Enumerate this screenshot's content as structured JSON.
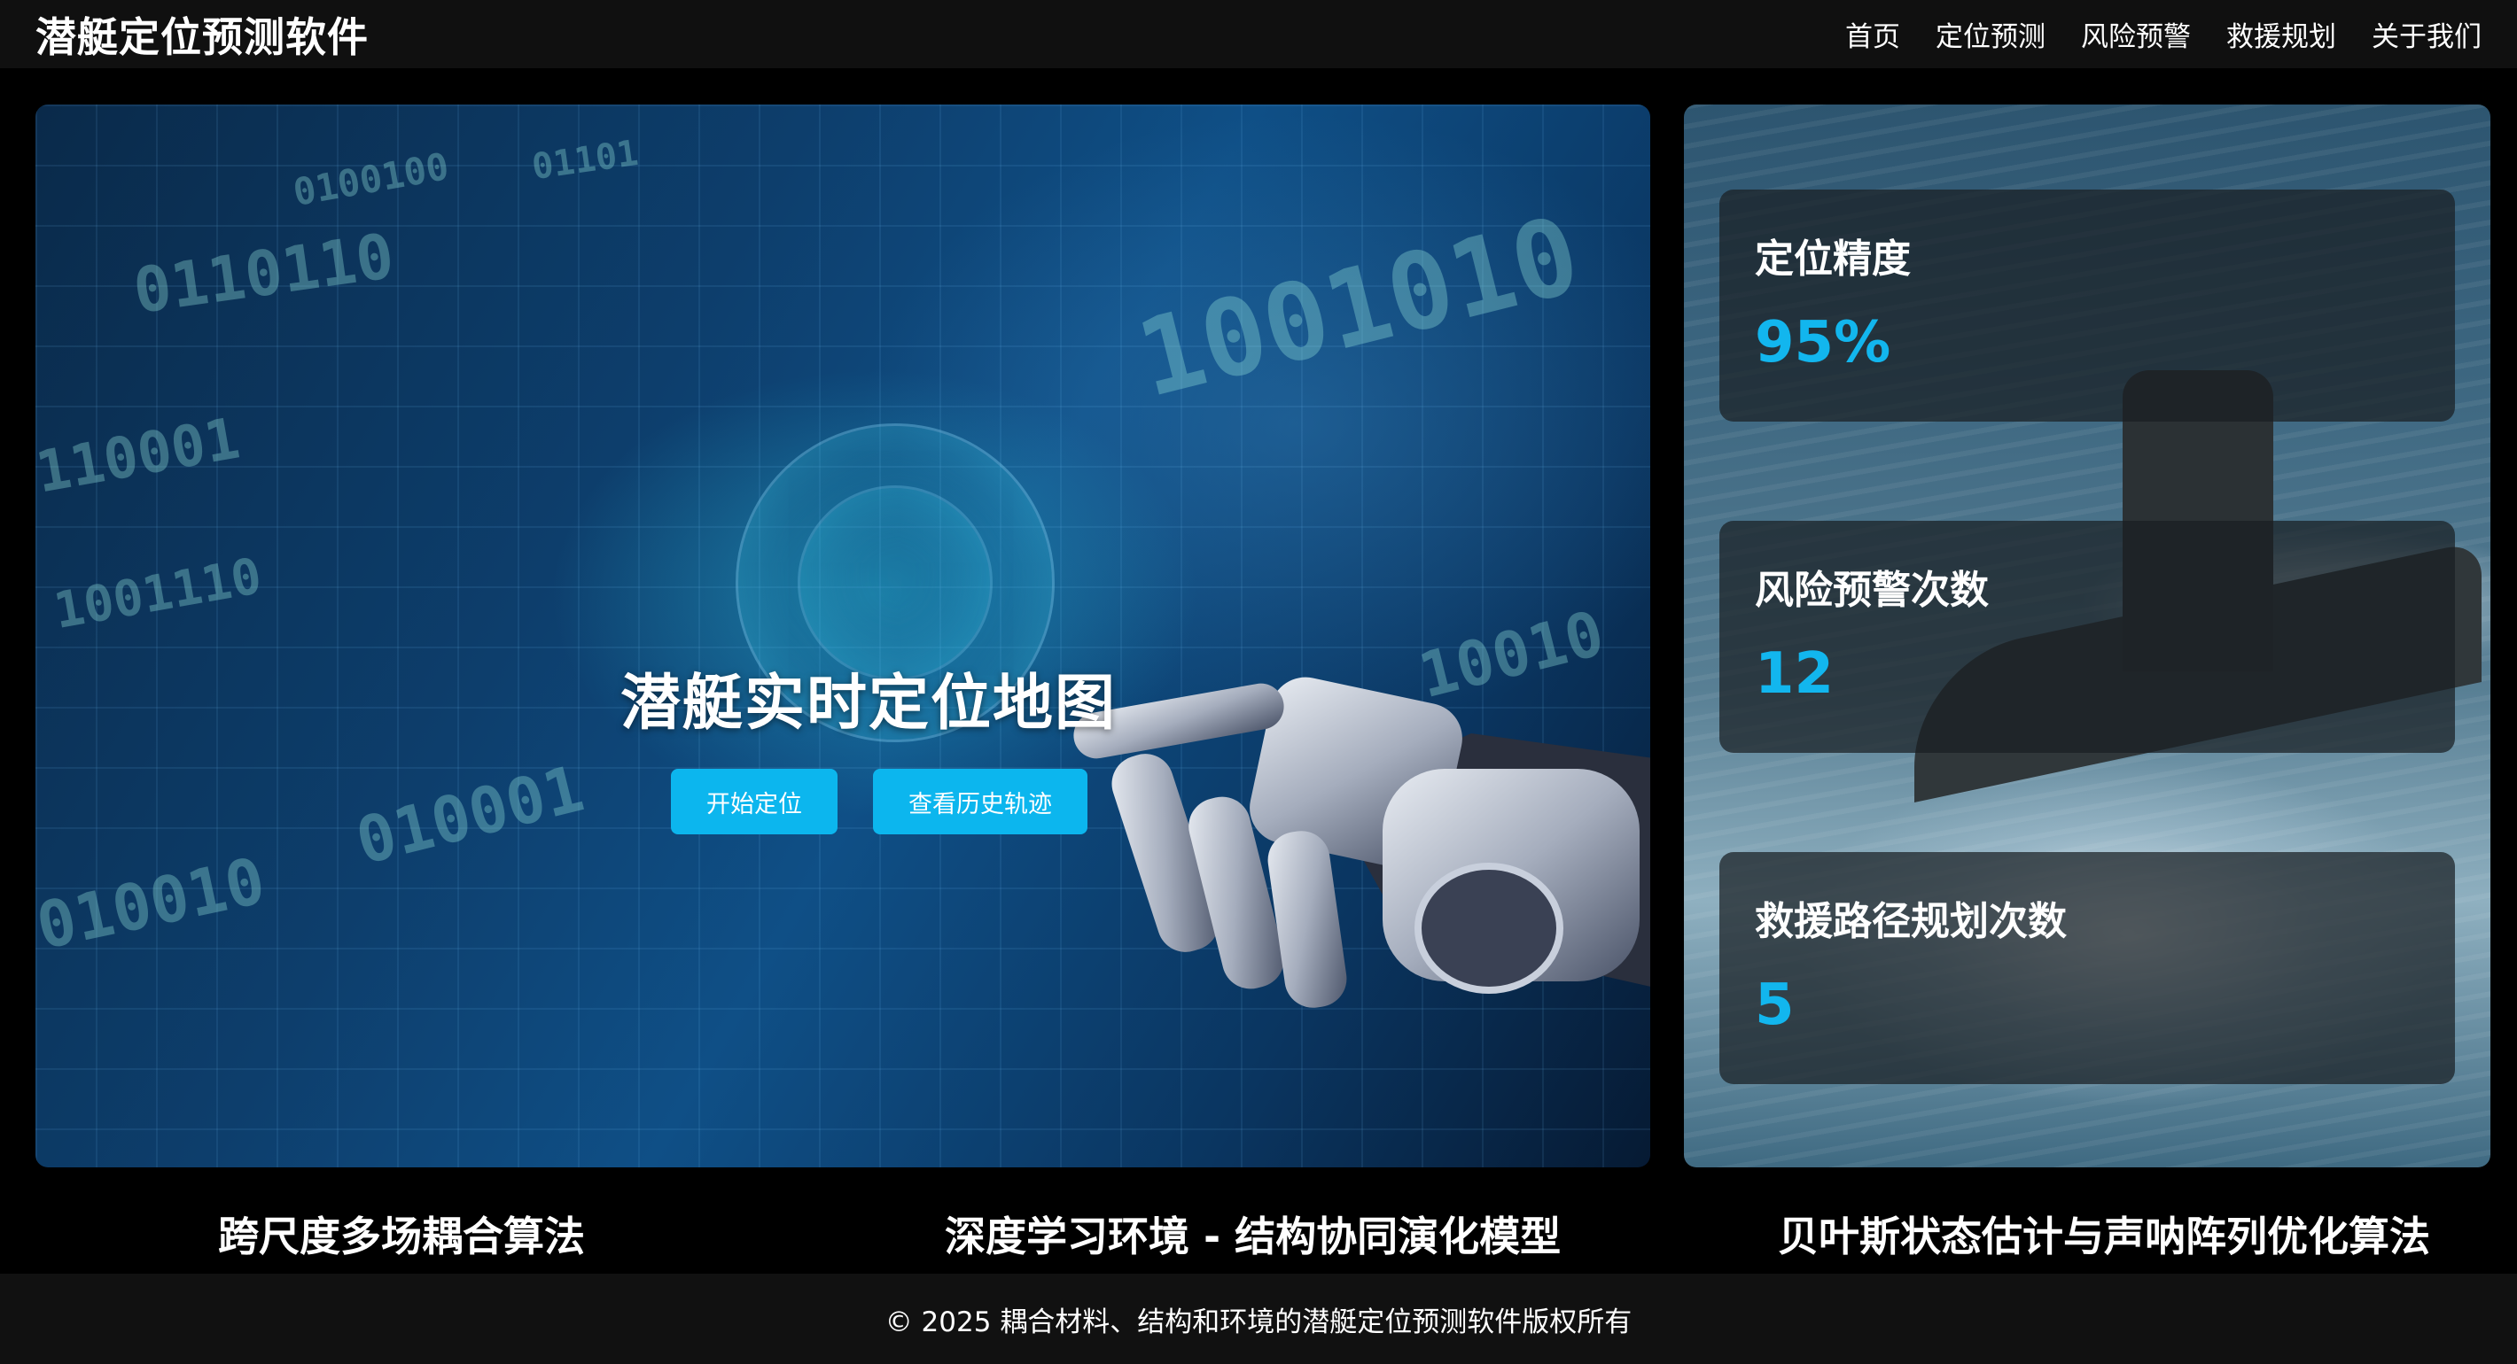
{
  "header": {
    "brand": "潜艇定位预测软件",
    "nav": [
      "首页",
      "定位预测",
      "风险预警",
      "救援规划",
      "关于我们"
    ]
  },
  "hero": {
    "title": "潜艇实时定位地图",
    "buttons": [
      "开始定位",
      "查看历史轨迹"
    ]
  },
  "stats": [
    {
      "label": "定位精度",
      "value": "95%"
    },
    {
      "label": "风险预警次数",
      "value": "12"
    },
    {
      "label": "救援路径规划次数",
      "value": "5"
    }
  ],
  "features": [
    "跨尺度多场耦合算法",
    "深度学习环境 - 结构协同演化模型",
    "贝叶斯状态估计与声呐阵列优化算法"
  ],
  "footer": {
    "text": "© 2025 耦合材料、结构和环境的潜艇定位预测软件版权所有"
  },
  "colors": {
    "accent": "#12b6ee",
    "button": "#0cb6ee",
    "header_bg": "#101010"
  }
}
